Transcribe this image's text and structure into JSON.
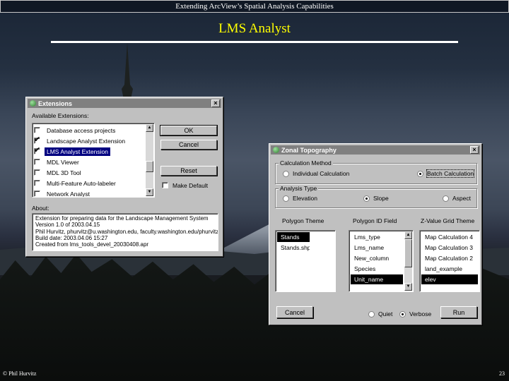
{
  "slide": {
    "header": "Extending ArcView’s Spatial Analysis Capabilities",
    "title": "LMS Analyst",
    "footer_left": "© Phil Hurvitz",
    "page_number": "23"
  },
  "extensions_dialog": {
    "title": "Extensions",
    "close_label": "×",
    "available_label": "Available Extensions:",
    "items": [
      {
        "label": "Database access projects",
        "checked": false,
        "selected": false
      },
      {
        "label": "Landscape Analyst Extension",
        "checked": true,
        "selected": false
      },
      {
        "label": "LMS Analyst Extension",
        "checked": true,
        "selected": true
      },
      {
        "label": "MDL Viewer",
        "checked": false,
        "selected": false
      },
      {
        "label": "MDL 3D Tool",
        "checked": false,
        "selected": false
      },
      {
        "label": "Multi-Feature Auto-labeler",
        "checked": false,
        "selected": false
      },
      {
        "label": "Network Analyst",
        "checked": false,
        "selected": false
      }
    ],
    "ok_label": "OK",
    "cancel_label": "Cancel",
    "reset_label": "Reset",
    "make_default_label": "Make Default",
    "about_label": "About:",
    "about_text": "Extension for preparing data for the Landscape Management System\nVersion 1.0 of 2003.04.15\nPhil Hurvitz, phurvitz@u.washington.edu, faculty.washington.edu/phurvitz\nBuild date: 2003.04.06 15:27\nCreated from lms_tools_devel_20030408.apr"
  },
  "zonal_dialog": {
    "title": "Zonal Topography",
    "close_label": "×",
    "calc_method_label": "Calculation Method",
    "calc_individual": "Individual Calculation",
    "calc_batch": "Batch Calculation",
    "analysis_type_label": "Analysis Type",
    "type_elevation": "Elevation",
    "type_slope": "Slope",
    "type_aspect": "Aspect",
    "polygon_theme_label": "Polygon Theme",
    "polygon_id_label": "Polygon ID Field",
    "grid_theme_label": "Z-Value Grid Theme",
    "polygon_themes": [
      {
        "label": "Stands",
        "selected": true
      },
      {
        "label": "Stands.shp",
        "selected": false
      }
    ],
    "id_fields": [
      {
        "label": "Lms_type",
        "selected": false
      },
      {
        "label": "Lms_name",
        "selected": false
      },
      {
        "label": "New_column",
        "selected": false
      },
      {
        "label": "Species",
        "selected": false
      },
      {
        "label": "Unit_name",
        "selected": true
      }
    ],
    "grid_themes": [
      {
        "label": "Map Calculation 4",
        "selected": false
      },
      {
        "label": "Map Calculation 3",
        "selected": false
      },
      {
        "label": "Map Calculation 2",
        "selected": false
      },
      {
        "label": "land_example",
        "selected": false
      },
      {
        "label": "elev",
        "selected": true
      }
    ],
    "cancel_label": "Cancel",
    "quiet_label": "Quiet",
    "verbose_label": "Verbose",
    "run_label": "Run"
  }
}
